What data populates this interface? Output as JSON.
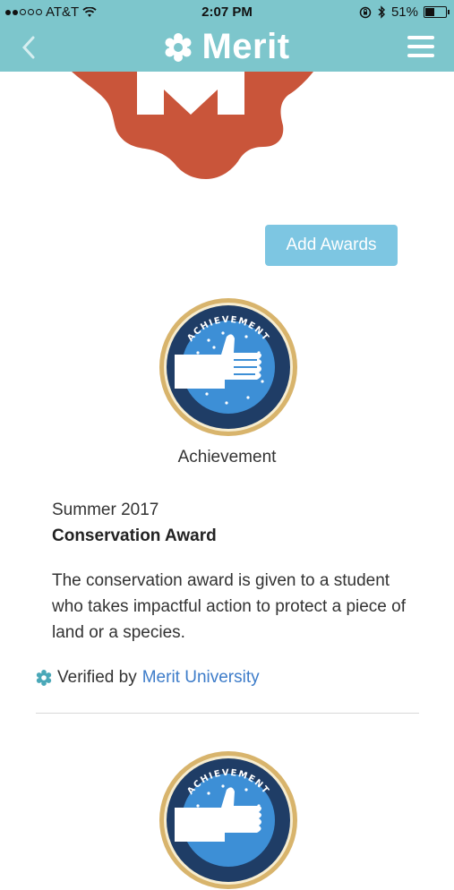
{
  "status_bar": {
    "carrier": "AT&T",
    "time": "2:07 PM",
    "battery": "51%",
    "battery_level": 0.51
  },
  "nav": {
    "title": "Merit"
  },
  "actions": {
    "add_awards_label": "Add Awards"
  },
  "award": {
    "badge_text": "ACHIEVEMENT",
    "badge_name": "Achievement",
    "term": "Summer 2017",
    "title": "Conservation Award",
    "description": "The conservation award is given to a student who takes impactful action to protect a piece of land or a species.",
    "verified_prefix": "Verified by",
    "verified_org": "Merit University"
  },
  "next_award": {
    "badge_text": "ACHIEVEMENT"
  },
  "colors": {
    "brand": "#7dc6cc",
    "button": "#7dc6e2",
    "logo": "#c9553a",
    "link": "#3d7cc9",
    "badge_blue": "#3d8fd6",
    "badge_navy": "#1f3d66",
    "badge_gold": "#d8b46c"
  }
}
